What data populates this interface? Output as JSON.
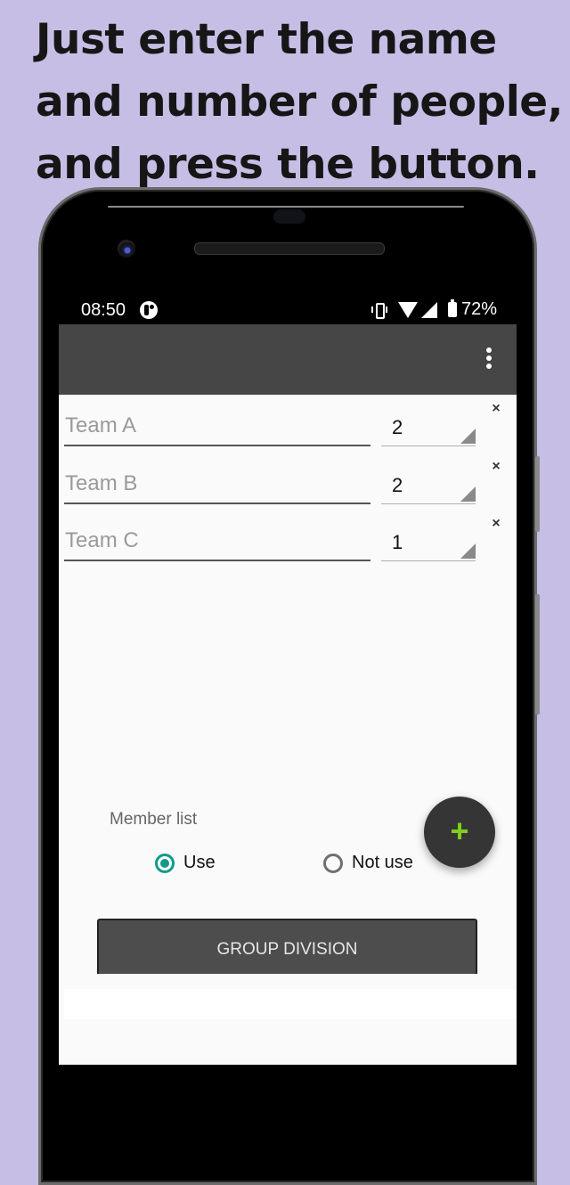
{
  "headline": {
    "lines": [
      "Just enter the name",
      "and number of people,",
      "and press the button."
    ]
  },
  "status_bar": {
    "time": "08:50",
    "icons": [
      "sync-icon",
      "vibrate-icon",
      "wifi-icon",
      "signal-icon",
      "battery-charging-icon"
    ],
    "battery_percent": "72%"
  },
  "app_bar": {
    "title": "",
    "overflow_icon": "more-vert-icon"
  },
  "teams": [
    {
      "name_value": "",
      "name_placeholder": "Team A",
      "count": "2",
      "remove_icon": "×"
    },
    {
      "name_value": "",
      "name_placeholder": "Team B",
      "count": "2",
      "remove_icon": "×"
    },
    {
      "name_value": "",
      "name_placeholder": "Team C",
      "count": "1",
      "remove_icon": "×"
    }
  ],
  "member_list": {
    "label": "Member list",
    "options": [
      {
        "label": "Use",
        "checked": true
      },
      {
        "label": "Not use",
        "checked": false
      }
    ]
  },
  "fab": {
    "icon": "+",
    "icon_name": "add-icon"
  },
  "group_button": {
    "label": "GROUP DIVISION"
  },
  "colors": {
    "background": "#c7bee6",
    "app_bar": "#464646",
    "accent_radio": "#139a8a",
    "fab_background": "#353535",
    "fab_icon": "#7fcf1c",
    "button_background": "#4d4d4d"
  }
}
